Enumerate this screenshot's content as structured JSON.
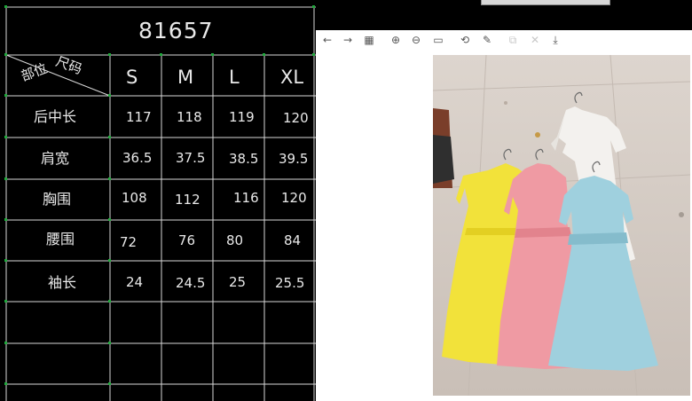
{
  "chart": {
    "title": "81657",
    "corner_top": "尺码",
    "corner_bottom": "部位",
    "sizes": [
      "S",
      "M",
      "L",
      "XL"
    ],
    "rows": [
      {
        "label": "后中长",
        "values": [
          "117",
          "118",
          "119",
          "120"
        ]
      },
      {
        "label": "肩宽",
        "values": [
          "36.5",
          "37.5",
          "38.5",
          "39.5"
        ]
      },
      {
        "label": "胸围",
        "values": [
          "108",
          "112",
          "116",
          "120"
        ]
      },
      {
        "label": "腰围",
        "values": [
          "72",
          "76",
          "80",
          "84"
        ]
      },
      {
        "label": "袖长",
        "values": [
          "24",
          "24.5",
          "25",
          "25.5"
        ]
      }
    ]
  },
  "viewer": {
    "toolbar": [
      {
        "icon": "arrow-left-icon",
        "glyph": "←",
        "enabled": true
      },
      {
        "icon": "arrow-right-icon",
        "glyph": "→",
        "enabled": true
      },
      {
        "icon": "grid-icon",
        "glyph": "▦",
        "enabled": true
      },
      {
        "icon": "zoom-in-icon",
        "glyph": "⊕",
        "enabled": true
      },
      {
        "icon": "zoom-out-icon",
        "glyph": "⊖",
        "enabled": true
      },
      {
        "icon": "actual-size-icon",
        "glyph": "▭",
        "enabled": true
      },
      {
        "icon": "rotate-icon",
        "glyph": "⟲",
        "enabled": true
      },
      {
        "icon": "edit-icon",
        "glyph": "✎",
        "enabled": true
      },
      {
        "icon": "copy-icon",
        "glyph": "⧉",
        "enabled": false
      },
      {
        "icon": "delete-icon",
        "glyph": "✕",
        "enabled": false
      },
      {
        "icon": "download-icon",
        "glyph": "⤓",
        "enabled": true
      }
    ],
    "photo": {
      "dresses": [
        {
          "name": "yellow-dress",
          "color": "#f2e23a"
        },
        {
          "name": "pink-dress",
          "color": "#ef9aa3"
        },
        {
          "name": "blue-dress",
          "color": "#9fd0de"
        },
        {
          "name": "white-dress",
          "color": "#f3f1ee"
        }
      ],
      "floor_color": "#d8cfc8"
    }
  }
}
